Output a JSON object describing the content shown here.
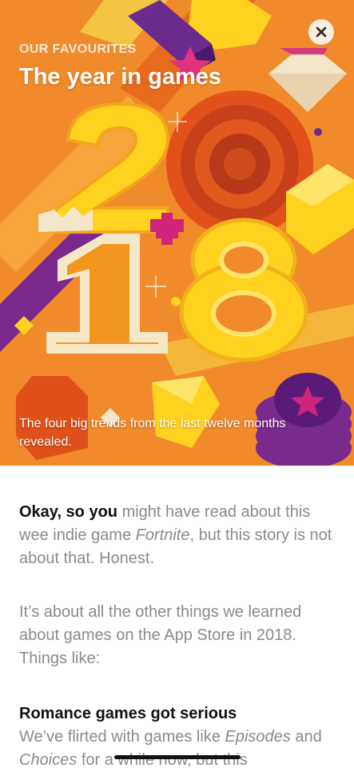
{
  "hero": {
    "eyebrow": "OUR FAVOURITES",
    "title": "The year in games",
    "subtitle": "The four big trends from the last twelve months revealed.",
    "art_numbers": [
      "2",
      "0",
      "1",
      "8"
    ],
    "background_color": "#f08a2b"
  },
  "close_button": {
    "icon": "close-icon"
  },
  "article": {
    "p1_bold": "Okay, so you",
    "p1_a": " might have read about this wee indie game ",
    "p1_italic": "Fortnite",
    "p1_b": ", but this story is not about that. Honest.",
    "p2": "It’s about all the other things we learned about games on the App Store in 2018. Things like:",
    "h1": "Romance games got serious",
    "p3_a": "We’ve flirted with games like ",
    "p3_italic1": "Episodes",
    "p3_b": " and ",
    "p3_italic2": "Choices",
    "p3_c": " for a while now, but this"
  }
}
